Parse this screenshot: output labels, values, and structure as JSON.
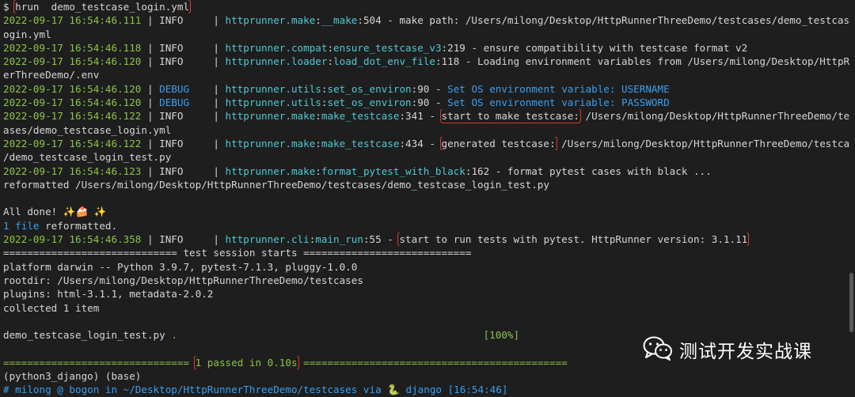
{
  "terminal": {
    "lines": [
      [
        [
          "w",
          "$ "
        ],
        [
          "hl",
          "hrun  demo_testcase_login.yml"
        ]
      ],
      [
        [
          "g",
          "2022-09-17 16:54:46.111"
        ],
        [
          "w",
          " | INFO     | "
        ],
        [
          "c",
          "httprunner.make"
        ],
        [
          "w",
          ":"
        ],
        [
          "c",
          "__make"
        ],
        [
          "w",
          ":504 - make path: /Users/milong/Desktop/HttpRunnerThreeDemo/testcases/demo_testcase_l"
        ]
      ],
      [
        [
          "w",
          "ogin.yml"
        ]
      ],
      [
        [
          "g",
          "2022-09-17 16:54:46.118"
        ],
        [
          "w",
          " | INFO     | "
        ],
        [
          "c",
          "httprunner.compat"
        ],
        [
          "w",
          ":"
        ],
        [
          "c",
          "ensure_testcase_v3"
        ],
        [
          "w",
          ":219 - ensure compatibility with testcase format v2"
        ]
      ],
      [
        [
          "g",
          "2022-09-17 16:54:46.120"
        ],
        [
          "w",
          " | INFO     | "
        ],
        [
          "c",
          "httprunner.loader"
        ],
        [
          "w",
          ":"
        ],
        [
          "c",
          "load_dot_env_file"
        ],
        [
          "w",
          ":118 - Loading environment variables from /Users/milong/Desktop/HttpRunn"
        ]
      ],
      [
        [
          "w",
          "erThreeDemo/.env"
        ]
      ],
      [
        [
          "g",
          "2022-09-17 16:54:46.120"
        ],
        [
          "w",
          " | "
        ],
        [
          "b",
          "DEBUG"
        ],
        [
          "w",
          "    | "
        ],
        [
          "c",
          "httprunner.utils"
        ],
        [
          "w",
          ":"
        ],
        [
          "c",
          "set_os_environ"
        ],
        [
          "w",
          ":90 - "
        ],
        [
          "b",
          "Set OS environment variable: USERNAME"
        ]
      ],
      [
        [
          "g",
          "2022-09-17 16:54:46.120"
        ],
        [
          "w",
          " | "
        ],
        [
          "b",
          "DEBUG"
        ],
        [
          "w",
          "    | "
        ],
        [
          "c",
          "httprunner.utils"
        ],
        [
          "w",
          ":"
        ],
        [
          "c",
          "set_os_environ"
        ],
        [
          "w",
          ":90 - "
        ],
        [
          "b",
          "Set OS environment variable: PASSWORD"
        ]
      ],
      [
        [
          "g",
          "2022-09-17 16:54:46.122"
        ],
        [
          "w",
          " | INFO     | "
        ],
        [
          "c",
          "httprunner.make"
        ],
        [
          "w",
          ":"
        ],
        [
          "c",
          "make_testcase"
        ],
        [
          "w",
          ":341 - "
        ],
        [
          "hl",
          "start to make testcase:"
        ],
        [
          "w",
          " /Users/milong/Desktop/HttpRunnerThreeDemo/testc"
        ]
      ],
      [
        [
          "w",
          "ases/demo_testcase_login.yml"
        ]
      ],
      [
        [
          "g",
          "2022-09-17 16:54:46.122"
        ],
        [
          "w",
          " | INFO     | "
        ],
        [
          "c",
          "httprunner.make"
        ],
        [
          "w",
          ":"
        ],
        [
          "c",
          "make_testcase"
        ],
        [
          "w",
          ":434 - "
        ],
        [
          "hl",
          "generated testcase:"
        ],
        [
          "w",
          " /Users/milong/Desktop/HttpRunnerThreeDemo/testcases"
        ]
      ],
      [
        [
          "w",
          "/demo_testcase_login_test.py"
        ]
      ],
      [
        [
          "g",
          "2022-09-17 16:54:46.123"
        ],
        [
          "w",
          " | INFO     | "
        ],
        [
          "c",
          "httprunner.make"
        ],
        [
          "w",
          ":"
        ],
        [
          "c",
          "format_pytest_with_black"
        ],
        [
          "w",
          ":162 - format pytest cases with black ..."
        ]
      ],
      [
        [
          "w",
          "reformatted /Users/milong/Desktop/HttpRunnerThreeDemo/testcases/demo_testcase_login_test.py"
        ]
      ],
      [
        [
          "w",
          ""
        ]
      ],
      [
        [
          "w",
          "All done! ✨🍰 ✨"
        ]
      ],
      [
        [
          "b",
          "1 file "
        ],
        [
          "w",
          "reformatted."
        ]
      ],
      [
        [
          "g",
          "2022-09-17 16:54:46.358"
        ],
        [
          "w",
          " | INFO     | "
        ],
        [
          "c",
          "httprunner.cli"
        ],
        [
          "w",
          ":"
        ],
        [
          "c",
          "main_run"
        ],
        [
          "w",
          ":55 - "
        ],
        [
          "hl",
          "start to run tests with pytest. HttpRunner version: 3.1.11"
        ]
      ],
      [
        [
          "w",
          "============================= test session starts ============================"
        ]
      ],
      [
        [
          "w",
          "platform darwin -- Python 3.9.7, pytest-7.1.3, pluggy-1.0.0"
        ]
      ],
      [
        [
          "w",
          "rootdir: /Users/milong/Desktop/HttpRunnerThreeDemo/testcases"
        ]
      ],
      [
        [
          "w",
          "plugins: html-3.1.1, metadata-2.0.2"
        ]
      ],
      [
        [
          "w",
          "collected 1 item"
        ]
      ],
      [
        [
          "w",
          ""
        ]
      ],
      [
        [
          "w",
          "demo_testcase_login_test.py "
        ],
        [
          "g",
          ".                                                   [100%]"
        ]
      ],
      [
        [
          "w",
          ""
        ]
      ],
      [
        [
          "g",
          "=============================== "
        ],
        [
          "hlg",
          "1 passed in 0.10s"
        ],
        [
          "g",
          " ============================================"
        ]
      ],
      [
        [
          "w",
          "(python3_django) (base)"
        ]
      ],
      [
        [
          "b",
          "# milong @ bogon in ~/Desktop/HttpRunnerThreeDemo/testcases via 🐍 django [16:54:46]"
        ]
      ]
    ]
  },
  "watermark": {
    "text": "测试开发实战课",
    "icon": "wechat-icon"
  }
}
